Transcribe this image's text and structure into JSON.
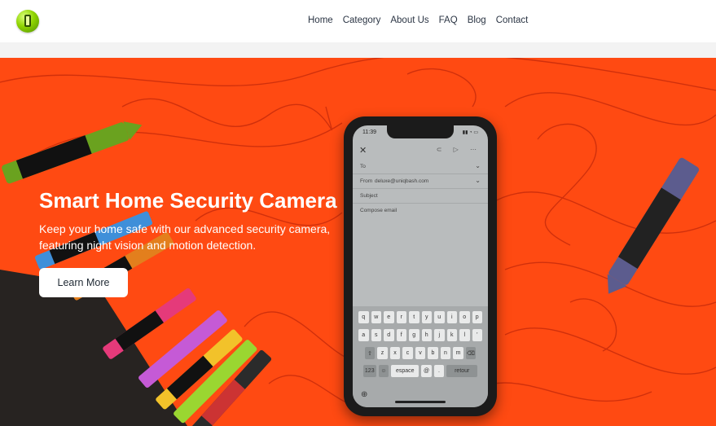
{
  "header": {
    "logo_icon": "phone-logo-icon",
    "nav": [
      {
        "label": "Home"
      },
      {
        "label": "Category"
      },
      {
        "label": "About Us"
      },
      {
        "label": "FAQ"
      },
      {
        "label": "Blog"
      },
      {
        "label": "Contact"
      }
    ]
  },
  "hero": {
    "title": "Smart Home Security Camera",
    "subtitle": "Keep your home safe with our advanced security camera, featuring night vision and motion detection.",
    "cta_label": "Learn More",
    "background_color": "#ff4a12"
  },
  "phone_screen": {
    "time": "11:39",
    "to_label": "To",
    "from_label": "From",
    "from_value": "deluxe@uniqbash.com",
    "subject_label": "Subject",
    "compose_label": "Compose email",
    "keyboard": {
      "row1": [
        "q",
        "w",
        "e",
        "r",
        "t",
        "y",
        "u",
        "i",
        "o",
        "p"
      ],
      "row2": [
        "a",
        "s",
        "d",
        "f",
        "g",
        "h",
        "j",
        "k",
        "l",
        "'"
      ],
      "row3": [
        "⇧",
        "z",
        "x",
        "c",
        "v",
        "b",
        "n",
        "m",
        "⌫"
      ],
      "num_label": "123",
      "space_label": "espace",
      "at_label": "@",
      "dot_label": ".",
      "return_label": "retour"
    }
  }
}
